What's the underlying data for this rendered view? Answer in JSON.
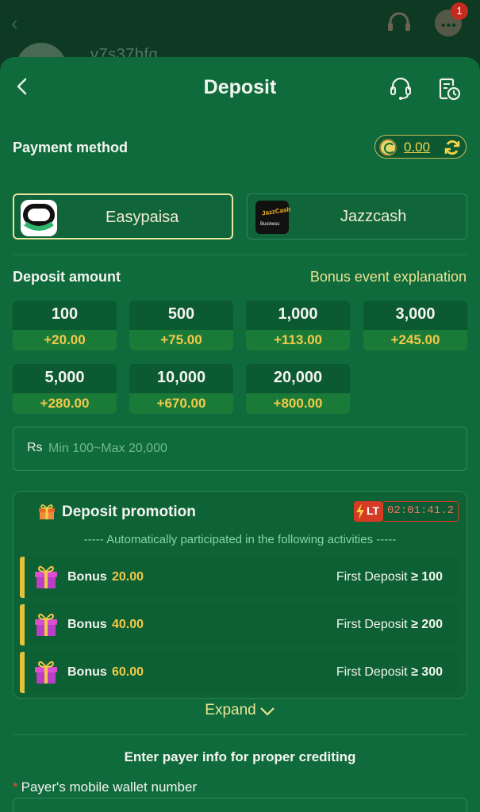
{
  "background": {
    "username": "v7s37bfq",
    "chat_badge": "1"
  },
  "header": {
    "title": "Deposit"
  },
  "payment": {
    "label": "Payment method",
    "balance": "0.00",
    "methods": [
      {
        "name": "Easypaisa",
        "selected": true
      },
      {
        "name": "Jazzcash",
        "selected": false,
        "logo_text": "JazzCash",
        "logo_sub": "Business"
      }
    ]
  },
  "deposit": {
    "label": "Deposit amount",
    "bonus_link": "Bonus event explanation",
    "amounts": [
      {
        "value": "100",
        "bonus": "+20.00"
      },
      {
        "value": "500",
        "bonus": "+75.00"
      },
      {
        "value": "1,000",
        "bonus": "+113.00"
      },
      {
        "value": "3,000",
        "bonus": "+245.00"
      },
      {
        "value": "5,000",
        "bonus": "+280.00"
      },
      {
        "value": "10,000",
        "bonus": "+670.00"
      },
      {
        "value": "20,000",
        "bonus": "+800.00"
      }
    ],
    "currency": "Rs",
    "placeholder": "Min 100~Max 20,000"
  },
  "promotion": {
    "title": "Deposit promotion",
    "badge": "LT",
    "timer": "02:01:41.2",
    "auto_text": "----- Automatically participated in the following activities -----",
    "rows": [
      {
        "label": "Bonus",
        "bonus": "20.00",
        "condition": "First Deposit",
        "op": "≥",
        "threshold": "100"
      },
      {
        "label": "Bonus",
        "bonus": "40.00",
        "condition": "First Deposit",
        "op": "≥",
        "threshold": "200"
      },
      {
        "label": "Bonus",
        "bonus": "60.00",
        "condition": "First Deposit",
        "op": "≥",
        "threshold": "300"
      }
    ],
    "expand": "Expand"
  },
  "payer": {
    "heading": "Enter payer info for proper crediting",
    "required_mark": "*",
    "wallet_label": "Payer's mobile wallet number"
  },
  "colors": {
    "sheet_bg": "#106b3c",
    "accent_yellow": "#f3c94a",
    "link_yellow": "#e9e08f",
    "timer_red": "#d43a24"
  }
}
